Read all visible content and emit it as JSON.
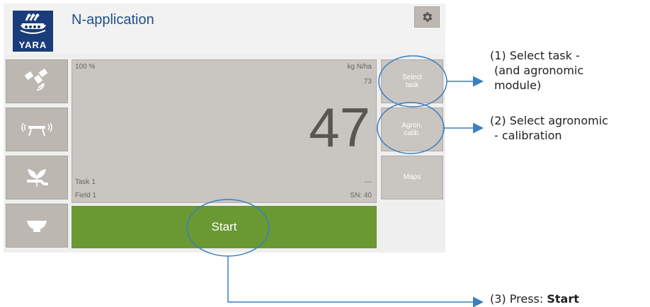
{
  "app": {
    "title": "N-application",
    "logo_text": "YARA"
  },
  "left_nav": [
    {
      "icon": "satellite-icon"
    },
    {
      "icon": "boom-spreader-icon"
    },
    {
      "icon": "plant-wrench-icon"
    },
    {
      "icon": "bowl-icon"
    }
  ],
  "display": {
    "percent": "100 %",
    "unit": "kg N/ha",
    "target": "73",
    "value": "47",
    "task": "Task 1",
    "field": "Field 1",
    "status": "---",
    "sn": "SN:  40"
  },
  "right_buttons": {
    "select_task": "Select task",
    "agron_calib": "Agron. calib.",
    "maps": "Maps"
  },
  "start_label": "Start",
  "callouts": {
    "c1_line1": "(1) Select task -",
    "c1_line2": "(and agronomic",
    "c1_line3": "module)",
    "c2_line1": "(2) Select agronomic",
    "c2_line2": "- calibration",
    "c3_prefix": "(3) Press: ",
    "c3_bold": "Start"
  },
  "colors": {
    "start_green": "#6a9832",
    "logo_blue": "#1a3c7a",
    "callout_blue": "#3a7fc0"
  }
}
